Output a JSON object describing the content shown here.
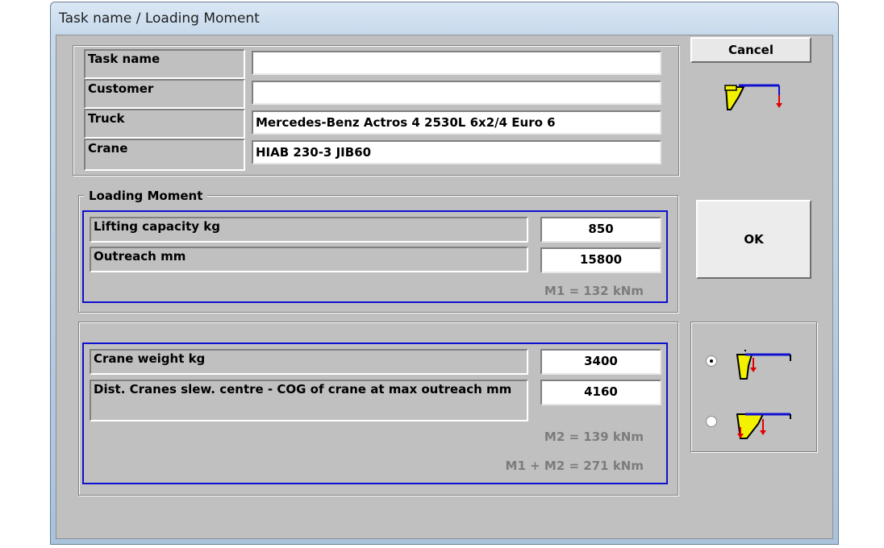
{
  "window": {
    "title": "Task name  /  Loading Moment"
  },
  "task_info": {
    "rows": [
      {
        "label": "Task name",
        "value": ""
      },
      {
        "label": "Customer",
        "value": ""
      },
      {
        "label": "Truck",
        "value": "Mercedes-Benz Actros 4 2530L 6x2/4 Euro 6"
      },
      {
        "label": "Crane",
        "value": "HIAB  230-3 JIB60"
      }
    ]
  },
  "loading_moment": {
    "title": "Loading Moment",
    "lifting_capacity": {
      "label": "Lifting capacity  kg",
      "value": "850"
    },
    "outreach": {
      "label": "Outreach  mm",
      "value": "15800"
    },
    "m1": "M1 = 132 kNm"
  },
  "crane_moment": {
    "crane_weight": {
      "label": "Crane weight  kg",
      "value": "3400"
    },
    "distance": {
      "label": "Dist. Cranes slew. centre - COG of crane at max outreach  mm",
      "value": "4160"
    },
    "m2": "M2 = 139 kNm",
    "total": "M1 + M2 = 271 kNm"
  },
  "buttons": {
    "cancel": "Cancel",
    "ok": "OK"
  },
  "options": {
    "selected": 0
  },
  "icons": {
    "crane_header": "crane-load-icon",
    "option_1": "crane-cog-icon",
    "option_2": "crane-double-cog-icon"
  },
  "colors": {
    "highlight_border": "#1010d0",
    "crane_yellow": "#f2f200",
    "load_arrow": "#e00000",
    "boom_blue": "#1010d0"
  }
}
